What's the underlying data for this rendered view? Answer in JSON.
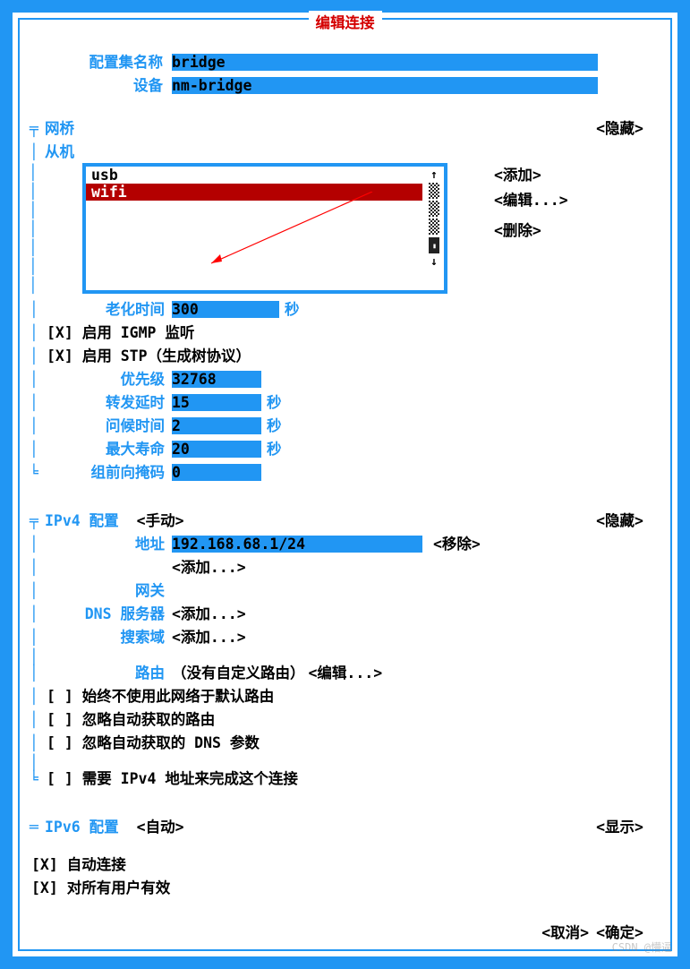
{
  "title": "编辑连接",
  "profile": {
    "name_label": "配置集名称",
    "name_value": "bridge",
    "device_label": "设备",
    "device_value": "nm-bridge"
  },
  "bridge": {
    "section_label": "网桥",
    "slaves_label": "从机",
    "hide_label": "<隐藏>",
    "slaves": [
      "usb",
      "wifi"
    ],
    "buttons": {
      "add": "<添加>",
      "edit": "<编辑...>",
      "delete": "<删除>"
    },
    "aging_label": "老化时间",
    "aging_value": "300",
    "aging_unit": "秒",
    "igmp_checked": "[X]",
    "igmp_label": "启用 IGMP 监听",
    "stp_checked": "[X]",
    "stp_label": "启用 STP（生成树协议）",
    "priority_label": "优先级",
    "priority_value": "32768",
    "fwd_delay_label": "转发延时",
    "fwd_delay_value": "15",
    "fwd_delay_unit": "秒",
    "hello_label": "问候时间",
    "hello_value": "2",
    "hello_unit": "秒",
    "maxage_label": "最大寿命",
    "maxage_value": "20",
    "maxage_unit": "秒",
    "gfm_label": "组前向掩码",
    "gfm_value": "0"
  },
  "ipv4": {
    "section_label": "IPv4 配置",
    "method": "<手动>",
    "hide_label": "<隐藏>",
    "addr_label": "地址",
    "addr_value": "192.168.68.1/24",
    "remove_label": "<移除>",
    "add_label": "<添加...>",
    "gateway_label": "网关",
    "gateway_value": "",
    "dns_label": "DNS 服务器",
    "dns_add": "<添加...>",
    "search_label": "搜索域",
    "search_add": "<添加...>",
    "routing_label": "路由",
    "routing_none": "（没有自定义路由）",
    "routing_edit": "<编辑...>",
    "never_default": "[ ] 始终不使用此网络于默认路由",
    "ignore_routes": "[ ] 忽略自动获取的路由",
    "ignore_dns": "[ ] 忽略自动获取的 DNS 参数",
    "require_ipv4": "[ ] 需要 IPv4 地址来完成这个连接"
  },
  "ipv6": {
    "section_label": "IPv6 配置",
    "method": "<自动>",
    "show_label": "<显示>"
  },
  "footer": {
    "auto_connect": "[X] 自动连接",
    "all_users": "[X] 对所有用户有效",
    "cancel": "<取消>",
    "ok": "<确定>"
  }
}
